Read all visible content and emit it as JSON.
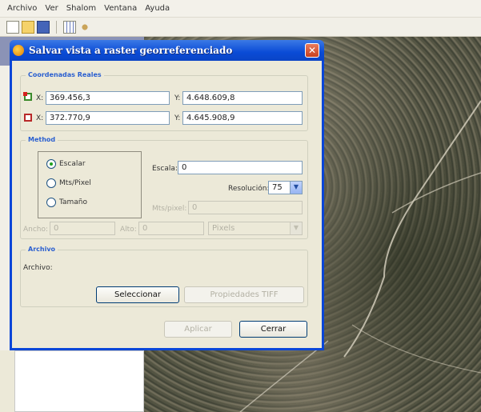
{
  "menubar": {
    "items": [
      "Archivo",
      "Ver",
      "Shalom",
      "Ventana",
      "Ayuda"
    ]
  },
  "dialog": {
    "title": "Salvar vista a raster georreferenciado",
    "close_label": "✕",
    "coords": {
      "legend": "Coordenadas Reales",
      "x_label": "X:",
      "y_label": "Y:",
      "x1": "369.456,3",
      "y1": "4.648.609,8",
      "x2": "372.770,9",
      "y2": "4.645.908,9"
    },
    "method": {
      "legend": "Method",
      "options": [
        "Escalar",
        "Mts/Pixel",
        "Tamaño"
      ],
      "selected": "Escalar",
      "escala_label": "Escala:",
      "escala_value": "0",
      "resolucion_label": "Resolución:",
      "resolucion_value": "75",
      "mtspixel_label": "Mts/pixel:",
      "mtspixel_value": "0",
      "ancho_label": "Ancho:",
      "ancho_value": "0",
      "alto_label": "Alto:",
      "alto_value": "0",
      "unit_value": "Pixels"
    },
    "archivo": {
      "legend": "Archivo",
      "label": "Archivo:",
      "select_label": "Seleccionar",
      "tiff_label": "Propiedades TIFF"
    },
    "aplicar_label": "Aplicar",
    "cerrar_label": "Cerrar"
  },
  "colors": {
    "titlebar": "#0a4bd6",
    "dialog_bg": "#ece9d8",
    "accent_green": "#21a121"
  }
}
